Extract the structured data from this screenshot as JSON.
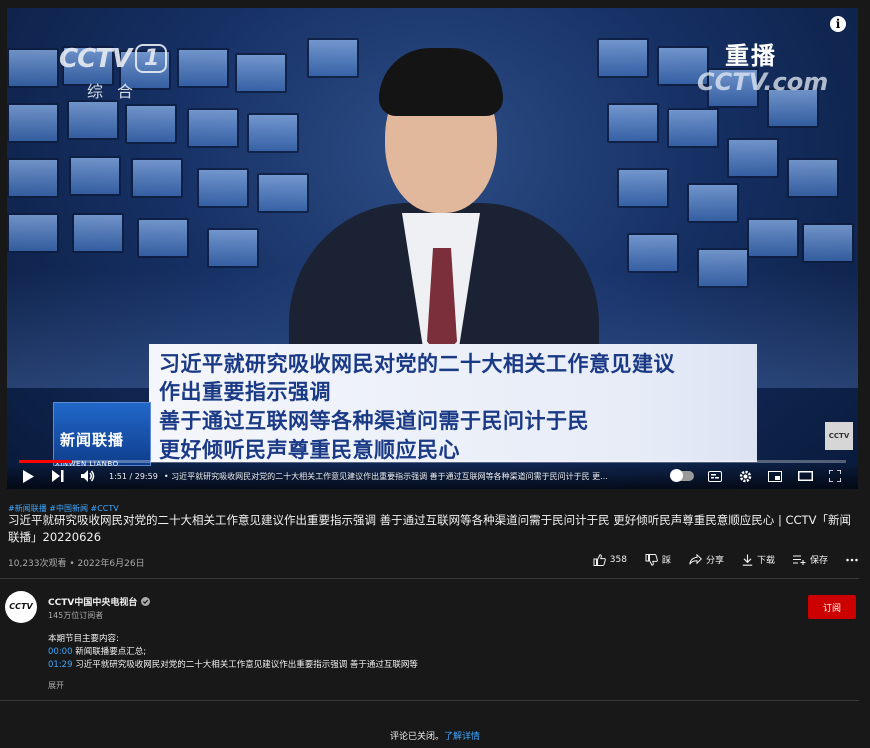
{
  "video": {
    "channel_logo": "CCTV",
    "channel_number": "1",
    "channel_sub": "综合",
    "replay_label": "重播",
    "watermark": "CCTV.com",
    "headline_lines": [
      "习近平就研究吸收网民对党的二十大相关工作意见建议",
      "作出重要指示强调",
      "善于通过互联网等各种渠道问需于民问计于民",
      "更好倾听民声尊重民意顺应民心"
    ],
    "program_logo": "新闻联播",
    "program_pinyin": "XINWEN  LIANBO",
    "corner_badge": "CCTV",
    "progress": 0.0637
  },
  "controls": {
    "time": "1:51 / 29:59",
    "chapter": "• 习近平就研究吸收网民对党的二十大相关工作意见建议作出重要指示强调 善于通过互联网等各种渠道问需于民问计于民 更..."
  },
  "meta": {
    "hashtags": "#新闻联播 #中国新闻 #CCTV",
    "title": "习近平就研究吸收网民对党的二十大相关工作意见建议作出重要指示强调 善于通过互联网等各种渠道问需于民问计于民 更好倾听民声尊重民意顺应民心 | CCTV「新闻联播」20220626",
    "views": "10,233次观看 • 2022年6月26日",
    "like_count": "358",
    "dislike_label": "踩",
    "share_label": "分享",
    "download_label": "下载",
    "save_label": "保存"
  },
  "channel": {
    "avatar_text": "CCTV",
    "name": "CCTV中国中央电视台",
    "subscribers": "145万位订阅者",
    "subscribe_label": "订阅"
  },
  "description": {
    "heading": "本期节目主要内容:",
    "chapters": [
      {
        "time": "00:00",
        "text": " 新闻联播要点汇总;"
      },
      {
        "time": "01:29",
        "text": " 习近平就研究吸收网民对党的二十大相关工作意见建议作出重要指示强调 善于通过互联网等"
      }
    ],
    "expand_label": "展开"
  },
  "comments": {
    "text": "评论已关闭。",
    "link": "了解详情"
  },
  "colors": {
    "accent_red": "#ff0000",
    "link_blue": "#3ea6ff",
    "headline_blue": "#1a3a86",
    "subscribe_red": "#cc0000"
  }
}
